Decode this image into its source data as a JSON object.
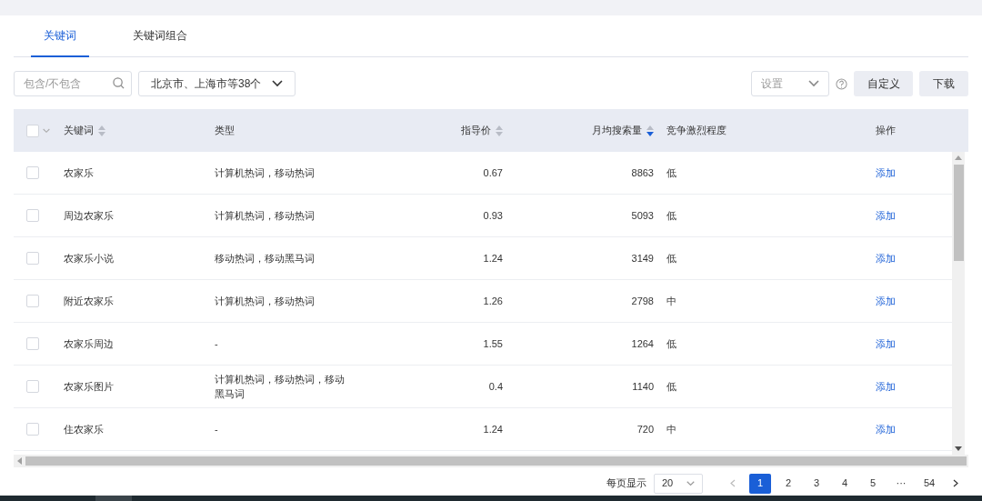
{
  "tabs": [
    {
      "label": "关键词",
      "selected": true
    },
    {
      "label": "关键词组合",
      "selected": false
    }
  ],
  "toolbar": {
    "search": {
      "placeholder": "包含/不包含"
    },
    "region": {
      "value": "北京市、上海市等38个"
    },
    "settings": {
      "placeholder": "设置"
    },
    "buttons": [
      "自定义",
      "下载"
    ]
  },
  "table": {
    "select_all": {
      "checked": false
    },
    "columns": [
      {
        "label": "关键词",
        "sorted": false
      },
      {
        "label": "类型"
      },
      {
        "label": "指导价",
        "sorted": false
      },
      {
        "label": "月均搜索量",
        "sorted": true
      },
      {
        "label": "竞争激烈程度"
      },
      {
        "label": "操作"
      }
    ],
    "rows": [
      {
        "checked": false,
        "keyword": "农家乐",
        "type": "计算机热词，移动热词",
        "price": "0.67",
        "searches": "8863",
        "competition": "低",
        "action": "添加"
      },
      {
        "checked": false,
        "keyword": "周边农家乐",
        "type": "计算机热词，移动热词",
        "price": "0.93",
        "searches": "5093",
        "competition": "低",
        "action": "添加"
      },
      {
        "checked": false,
        "keyword": "农家乐小说",
        "type": "移动热词，移动黑马词",
        "price": "1.24",
        "searches": "3149",
        "competition": "低",
        "action": "添加"
      },
      {
        "checked": false,
        "keyword": "附近农家乐",
        "type": "计算机热词，移动热词",
        "price": "1.26",
        "searches": "2798",
        "competition": "中",
        "action": "添加"
      },
      {
        "checked": false,
        "keyword": "农家乐周边",
        "type": "-",
        "price": "1.55",
        "searches": "1264",
        "competition": "低",
        "action": "添加"
      },
      {
        "checked": false,
        "keyword": "农家乐图片",
        "type": "计算机热词，移动热词，移动黑马词",
        "price": "0.4",
        "searches": "1140",
        "competition": "低",
        "action": "添加"
      },
      {
        "checked": false,
        "keyword": "住农家乐",
        "type": "-",
        "price": "1.24",
        "searches": "720",
        "competition": "中",
        "action": "添加"
      }
    ]
  },
  "pagination": {
    "page_size_label": "每页显示",
    "page_size": "20",
    "pages": [
      {
        "label": "1",
        "selected": true
      },
      {
        "label": "2",
        "selected": false
      },
      {
        "label": "3",
        "selected": false
      },
      {
        "label": "4",
        "selected": false
      },
      {
        "label": "5",
        "selected": false
      },
      {
        "label": "···",
        "selected": false
      },
      {
        "label": "54",
        "selected": false
      }
    ]
  }
}
